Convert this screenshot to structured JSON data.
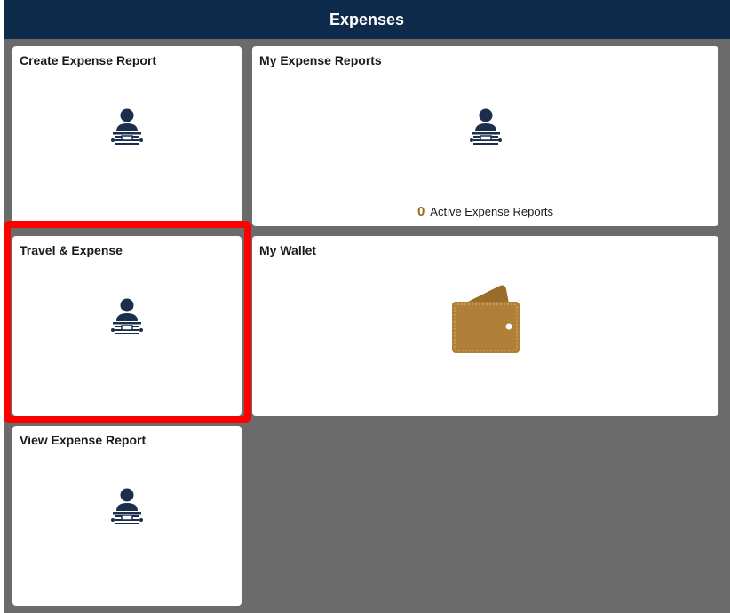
{
  "header": {
    "title": "Expenses"
  },
  "tiles": [
    {
      "id": "create-expense-report",
      "title": "Create Expense Report",
      "icon": "person-at-desk-icon"
    },
    {
      "id": "my-expense-reports",
      "title": "My Expense Reports",
      "icon": "person-at-desk-icon",
      "count": "0",
      "count_label": "Active Expense Reports"
    },
    {
      "id": "travel-and-expense",
      "title": "Travel & Expense",
      "icon": "person-at-desk-icon",
      "highlighted": true
    },
    {
      "id": "my-wallet",
      "title": "My Wallet",
      "icon": "wallet-icon"
    },
    {
      "id": "view-expense-report",
      "title": "View Expense Report",
      "icon": "person-at-desk-icon"
    }
  ],
  "colors": {
    "header_bg": "#0f2b4b",
    "icon": "#1b2f4c",
    "wallet": "#b07f38",
    "count": "#a06a18",
    "highlight": "#ff0000",
    "background": "#6b6b6b"
  }
}
